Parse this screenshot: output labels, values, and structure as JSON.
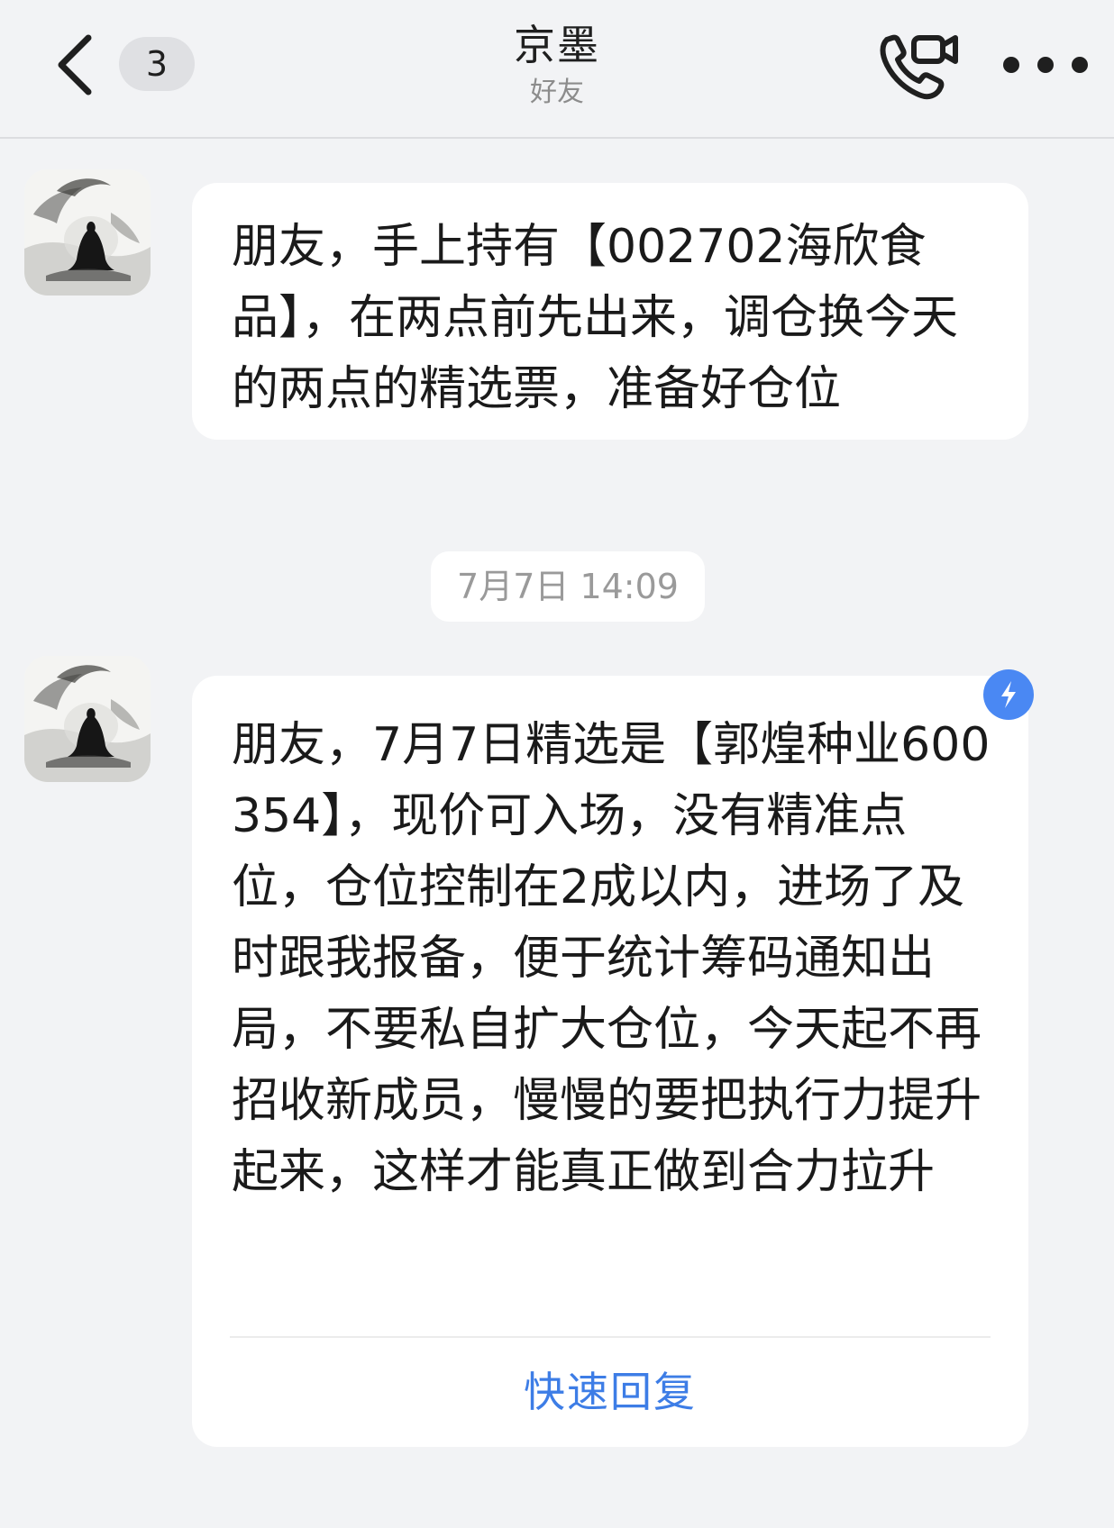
{
  "header": {
    "back_icon": "chevron-left-icon",
    "unread_count": "3",
    "contact_name": "京墨",
    "relation": "好友",
    "call_icon": "video-call-icon",
    "more_icon": "more-dots-icon"
  },
  "messages": [
    {
      "avatar_icon": "ink-painting-avatar",
      "text": "朋友，手上持有【002702海欣食品】，在两点前先出来，调仓换今天的两点的精选票，准备好仓位"
    },
    {
      "avatar_icon": "ink-painting-avatar",
      "text": "朋友，7月7日精选是【郭煌种业600354】，现价可入场，没有精准点位，仓位控制在2成以内，进场了及时跟我报备，便于统计筹码通知出局，不要私自扩大仓位，今天起不再招收新成员，慢慢的要把执行力提升起来，这样才能真正做到合力拉升",
      "badge_icon": "flash-icon",
      "quick_reply_label": "快速回复"
    }
  ],
  "timestamp": "7月7日 14:09",
  "colors": {
    "background": "#f2f3f5",
    "bubble": "#ffffff",
    "accent": "#3d7de6",
    "badge": "#4a88f3"
  }
}
